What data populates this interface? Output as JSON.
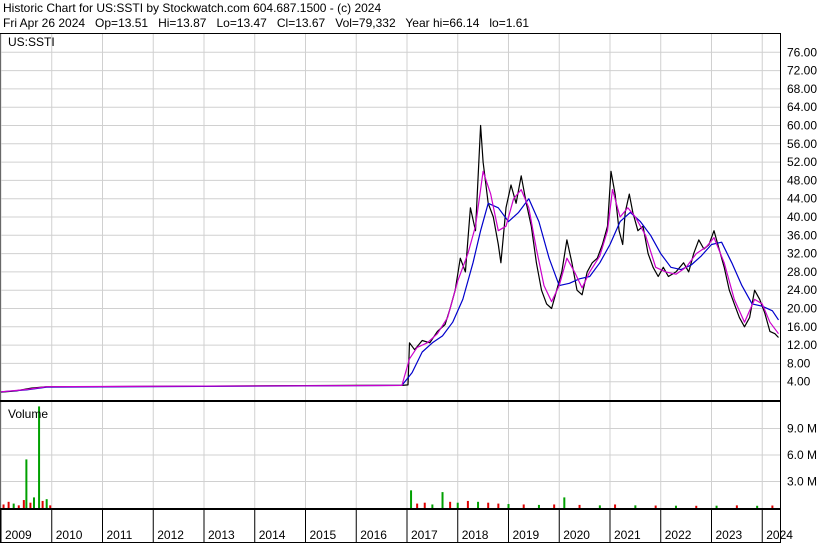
{
  "header": {
    "line1": "Historic Chart for US:SSTI by Stockwatch.com 604.687.1500 - (c) 2024",
    "line2": "Fri Apr 26 2024   Op=13.51   Hi=13.87   Lo=13.47   Cl=13.67   Vol=79,332   Year hi=66.14   lo=1.61"
  },
  "chart_data": [
    {
      "type": "line",
      "title": "US:SSTI",
      "y_axis_side": "right",
      "ylim": [
        0,
        80
      ],
      "yticks": [
        "76.00",
        "72.00",
        "68.00",
        "64.00",
        "60.00",
        "56.00",
        "52.00",
        "48.00",
        "44.00",
        "40.00",
        "36.00",
        "32.00",
        "28.00",
        "24.00",
        "20.00",
        "16.00",
        "12.00",
        "8.00",
        "4.00"
      ],
      "ytick_values": [
        76,
        72,
        68,
        64,
        60,
        56,
        52,
        48,
        44,
        40,
        36,
        32,
        28,
        24,
        20,
        16,
        12,
        8,
        4
      ],
      "xlim": [
        2009.0,
        2024.35
      ],
      "xticks": [
        "2009",
        "2010",
        "2011",
        "2012",
        "2013",
        "2014",
        "2015",
        "2016",
        "2017",
        "2018",
        "2019",
        "2020",
        "2021",
        "2022",
        "2023",
        "2024"
      ],
      "xtick_values": [
        2009,
        2010,
        2011,
        2012,
        2013,
        2014,
        2015,
        2016,
        2017,
        2018,
        2019,
        2020,
        2021,
        2022,
        2023,
        2024
      ],
      "colors": {
        "price": "#000000",
        "ma_short": "#cc00cc",
        "ma_long": "#0000cc"
      },
      "price": [
        [
          2009.0,
          1.7
        ],
        [
          2009.3,
          2.0
        ],
        [
          2009.6,
          2.6
        ],
        [
          2009.9,
          2.9
        ],
        [
          2010.5,
          2.9
        ],
        [
          2012.0,
          3.0
        ],
        [
          2014.0,
          3.1
        ],
        [
          2016.0,
          3.2
        ],
        [
          2016.9,
          3.2
        ],
        [
          2017.02,
          3.3
        ],
        [
          2017.05,
          12.5
        ],
        [
          2017.15,
          11.0
        ],
        [
          2017.3,
          13.0
        ],
        [
          2017.45,
          12.5
        ],
        [
          2017.6,
          15.0
        ],
        [
          2017.75,
          16.5
        ],
        [
          2017.85,
          20.0
        ],
        [
          2017.95,
          24.0
        ],
        [
          2018.05,
          31.0
        ],
        [
          2018.15,
          28.0
        ],
        [
          2018.25,
          42.0
        ],
        [
          2018.35,
          37.0
        ],
        [
          2018.45,
          60.0
        ],
        [
          2018.5,
          52.0
        ],
        [
          2018.6,
          43.0
        ],
        [
          2018.7,
          40.0
        ],
        [
          2018.8,
          34.0
        ],
        [
          2018.85,
          30.0
        ],
        [
          2018.95,
          42.0
        ],
        [
          2019.05,
          47.0
        ],
        [
          2019.15,
          43.0
        ],
        [
          2019.25,
          49.0
        ],
        [
          2019.35,
          43.0
        ],
        [
          2019.45,
          38.0
        ],
        [
          2019.55,
          30.0
        ],
        [
          2019.65,
          24.0
        ],
        [
          2019.75,
          21.0
        ],
        [
          2019.85,
          20.0
        ],
        [
          2019.95,
          24.0
        ],
        [
          2020.05,
          28.0
        ],
        [
          2020.15,
          35.0
        ],
        [
          2020.25,
          30.0
        ],
        [
          2020.35,
          24.0
        ],
        [
          2020.45,
          23.0
        ],
        [
          2020.55,
          28.0
        ],
        [
          2020.65,
          30.0
        ],
        [
          2020.75,
          31.0
        ],
        [
          2020.85,
          34.0
        ],
        [
          2020.95,
          38.0
        ],
        [
          2021.02,
          50.0
        ],
        [
          2021.1,
          45.0
        ],
        [
          2021.18,
          37.0
        ],
        [
          2021.25,
          34.0
        ],
        [
          2021.3,
          41.0
        ],
        [
          2021.38,
          45.0
        ],
        [
          2021.45,
          41.0
        ],
        [
          2021.55,
          37.0
        ],
        [
          2021.65,
          38.0
        ],
        [
          2021.75,
          32.0
        ],
        [
          2021.85,
          29.0
        ],
        [
          2021.95,
          27.0
        ],
        [
          2022.05,
          29.0
        ],
        [
          2022.15,
          27.0
        ],
        [
          2022.3,
          28.0
        ],
        [
          2022.45,
          30.0
        ],
        [
          2022.55,
          28.0
        ],
        [
          2022.65,
          32.0
        ],
        [
          2022.75,
          35.0
        ],
        [
          2022.85,
          33.0
        ],
        [
          2022.95,
          34.0
        ],
        [
          2023.05,
          37.0
        ],
        [
          2023.15,
          33.0
        ],
        [
          2023.25,
          29.0
        ],
        [
          2023.35,
          24.0
        ],
        [
          2023.45,
          21.0
        ],
        [
          2023.55,
          18.0
        ],
        [
          2023.65,
          16.0
        ],
        [
          2023.75,
          18.0
        ],
        [
          2023.85,
          24.0
        ],
        [
          2023.95,
          22.0
        ],
        [
          2024.05,
          19.0
        ],
        [
          2024.15,
          15.0
        ],
        [
          2024.25,
          14.5
        ],
        [
          2024.32,
          13.67
        ]
      ],
      "ma_short": [
        [
          2009.0,
          1.8
        ],
        [
          2009.5,
          2.3
        ],
        [
          2009.9,
          2.9
        ],
        [
          2016.9,
          3.2
        ],
        [
          2017.05,
          9.0
        ],
        [
          2017.2,
          11.5
        ],
        [
          2017.4,
          12.5
        ],
        [
          2017.6,
          14.5
        ],
        [
          2017.8,
          18.0
        ],
        [
          2018.0,
          26.0
        ],
        [
          2018.2,
          32.0
        ],
        [
          2018.35,
          38.0
        ],
        [
          2018.5,
          50.0
        ],
        [
          2018.65,
          45.0
        ],
        [
          2018.8,
          37.0
        ],
        [
          2018.95,
          38.0
        ],
        [
          2019.1,
          44.0
        ],
        [
          2019.25,
          46.0
        ],
        [
          2019.4,
          42.0
        ],
        [
          2019.55,
          33.0
        ],
        [
          2019.7,
          25.0
        ],
        [
          2019.85,
          21.5
        ],
        [
          2020.0,
          25.0
        ],
        [
          2020.15,
          31.0
        ],
        [
          2020.3,
          28.0
        ],
        [
          2020.45,
          24.5
        ],
        [
          2020.6,
          28.0
        ],
        [
          2020.8,
          31.5
        ],
        [
          2020.95,
          37.0
        ],
        [
          2021.05,
          46.0
        ],
        [
          2021.2,
          40.0
        ],
        [
          2021.35,
          42.0
        ],
        [
          2021.5,
          40.0
        ],
        [
          2021.7,
          36.0
        ],
        [
          2021.9,
          29.0
        ],
        [
          2022.1,
          28.0
        ],
        [
          2022.3,
          27.5
        ],
        [
          2022.5,
          29.0
        ],
        [
          2022.7,
          32.0
        ],
        [
          2022.9,
          33.5
        ],
        [
          2023.05,
          35.5
        ],
        [
          2023.25,
          30.0
        ],
        [
          2023.45,
          22.0
        ],
        [
          2023.65,
          17.0
        ],
        [
          2023.85,
          22.0
        ],
        [
          2024.0,
          21.0
        ],
        [
          2024.15,
          17.0
        ],
        [
          2024.32,
          14.5
        ]
      ],
      "ma_long": [
        [
          2009.0,
          1.8
        ],
        [
          2009.5,
          2.2
        ],
        [
          2009.9,
          2.8
        ],
        [
          2016.9,
          3.2
        ],
        [
          2017.1,
          6.0
        ],
        [
          2017.3,
          10.5
        ],
        [
          2017.5,
          12.5
        ],
        [
          2017.7,
          14.0
        ],
        [
          2017.9,
          17.0
        ],
        [
          2018.1,
          22.0
        ],
        [
          2018.3,
          30.0
        ],
        [
          2018.45,
          37.0
        ],
        [
          2018.6,
          43.0
        ],
        [
          2018.8,
          42.0
        ],
        [
          2019.0,
          39.0
        ],
        [
          2019.2,
          41.0
        ],
        [
          2019.4,
          44.0
        ],
        [
          2019.6,
          39.0
        ],
        [
          2019.8,
          31.0
        ],
        [
          2020.0,
          25.0
        ],
        [
          2020.2,
          25.5
        ],
        [
          2020.4,
          26.5
        ],
        [
          2020.6,
          27.0
        ],
        [
          2020.8,
          30.0
        ],
        [
          2021.0,
          34.0
        ],
        [
          2021.2,
          39.0
        ],
        [
          2021.4,
          41.0
        ],
        [
          2021.6,
          39.0
        ],
        [
          2021.8,
          36.0
        ],
        [
          2022.0,
          32.0
        ],
        [
          2022.2,
          29.0
        ],
        [
          2022.4,
          28.5
        ],
        [
          2022.6,
          29.5
        ],
        [
          2022.8,
          31.5
        ],
        [
          2023.0,
          34.0
        ],
        [
          2023.2,
          34.5
        ],
        [
          2023.4,
          30.0
        ],
        [
          2023.6,
          25.0
        ],
        [
          2023.8,
          21.0
        ],
        [
          2024.0,
          20.5
        ],
        [
          2024.2,
          19.5
        ],
        [
          2024.32,
          17.5
        ]
      ]
    },
    {
      "type": "bar",
      "title": "Volume",
      "y_axis_side": "right",
      "ylim": [
        0,
        12000000
      ],
      "yticks": [
        "9.0 M",
        "6.0 M",
        "3.0 M"
      ],
      "ytick_values": [
        9000000,
        6000000,
        3000000
      ],
      "colors": {
        "up": "#00a000",
        "down": "#dd0000"
      },
      "bars": [
        [
          2009.05,
          400000,
          "down"
        ],
        [
          2009.15,
          700000,
          "down"
        ],
        [
          2009.25,
          500000,
          "up"
        ],
        [
          2009.35,
          300000,
          "down"
        ],
        [
          2009.45,
          900000,
          "down"
        ],
        [
          2009.5,
          5500000,
          "up"
        ],
        [
          2009.58,
          600000,
          "down"
        ],
        [
          2009.65,
          1200000,
          "up"
        ],
        [
          2009.75,
          11500000,
          "up"
        ],
        [
          2009.82,
          800000,
          "down"
        ],
        [
          2009.9,
          1000000,
          "up"
        ],
        [
          2009.97,
          300000,
          "down"
        ],
        [
          2017.08,
          2000000,
          "up"
        ],
        [
          2017.2,
          500000,
          "down"
        ],
        [
          2017.35,
          600000,
          "down"
        ],
        [
          2017.5,
          400000,
          "up"
        ],
        [
          2017.7,
          1800000,
          "up"
        ],
        [
          2017.85,
          700000,
          "down"
        ],
        [
          2018.0,
          600000,
          "up"
        ],
        [
          2018.2,
          800000,
          "down"
        ],
        [
          2018.4,
          700000,
          "up"
        ],
        [
          2018.6,
          600000,
          "down"
        ],
        [
          2018.8,
          500000,
          "down"
        ],
        [
          2019.0,
          450000,
          "up"
        ],
        [
          2019.3,
          400000,
          "down"
        ],
        [
          2019.6,
          350000,
          "up"
        ],
        [
          2019.9,
          400000,
          "down"
        ],
        [
          2020.1,
          1200000,
          "up"
        ],
        [
          2020.4,
          350000,
          "down"
        ],
        [
          2020.8,
          300000,
          "up"
        ],
        [
          2021.1,
          400000,
          "down"
        ],
        [
          2021.5,
          300000,
          "up"
        ],
        [
          2021.9,
          280000,
          "down"
        ],
        [
          2022.3,
          260000,
          "up"
        ],
        [
          2022.7,
          250000,
          "down"
        ],
        [
          2023.1,
          260000,
          "up"
        ],
        [
          2023.5,
          300000,
          "down"
        ],
        [
          2023.9,
          250000,
          "up"
        ],
        [
          2024.2,
          280000,
          "down"
        ]
      ]
    }
  ]
}
